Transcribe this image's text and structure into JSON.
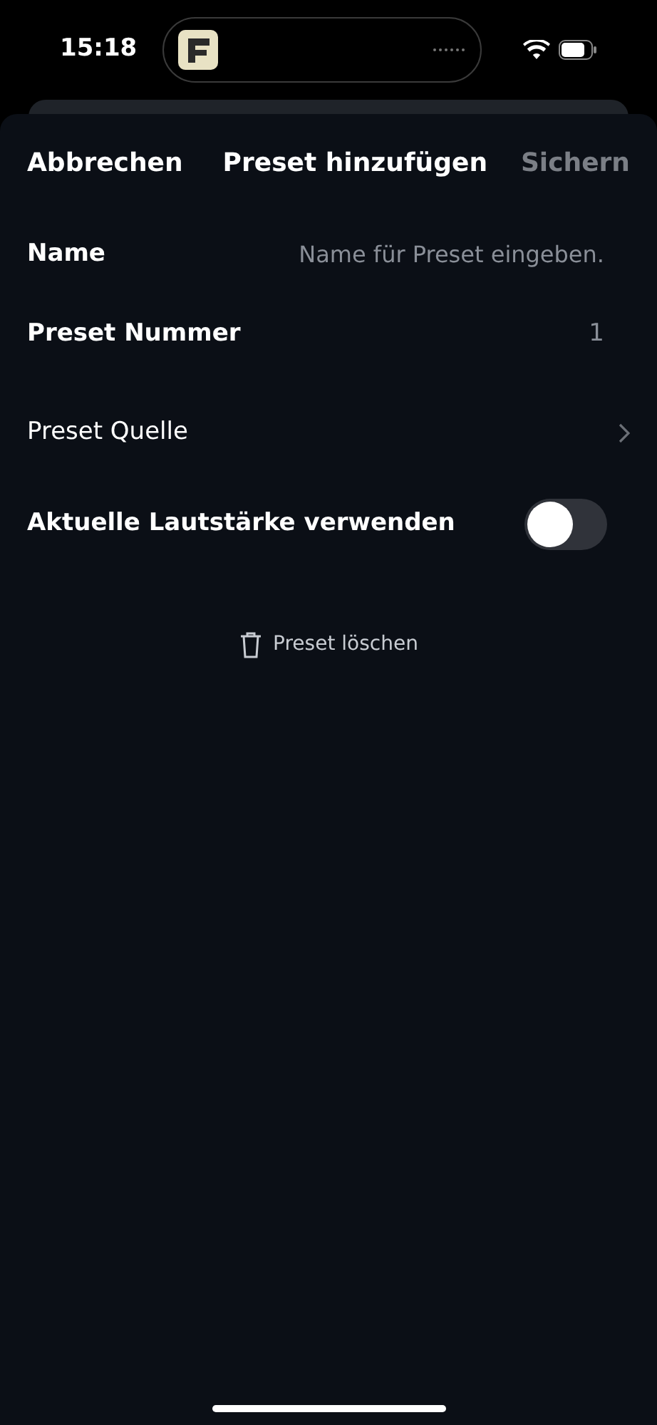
{
  "status_bar": {
    "time": "15:18"
  },
  "nav": {
    "cancel": "Abbrechen",
    "title": "Preset hinzufügen",
    "save": "Sichern",
    "save_disabled": true
  },
  "form": {
    "name": {
      "label": "Name",
      "placeholder": "Name für Preset eingeben."
    },
    "number": {
      "label": "Preset Nummer",
      "value": "1"
    },
    "source": {
      "label": "Preset Quelle"
    },
    "volume": {
      "label": "Aktuelle Lautstärke verwenden",
      "on": false
    }
  },
  "delete_button": "Preset löschen"
}
